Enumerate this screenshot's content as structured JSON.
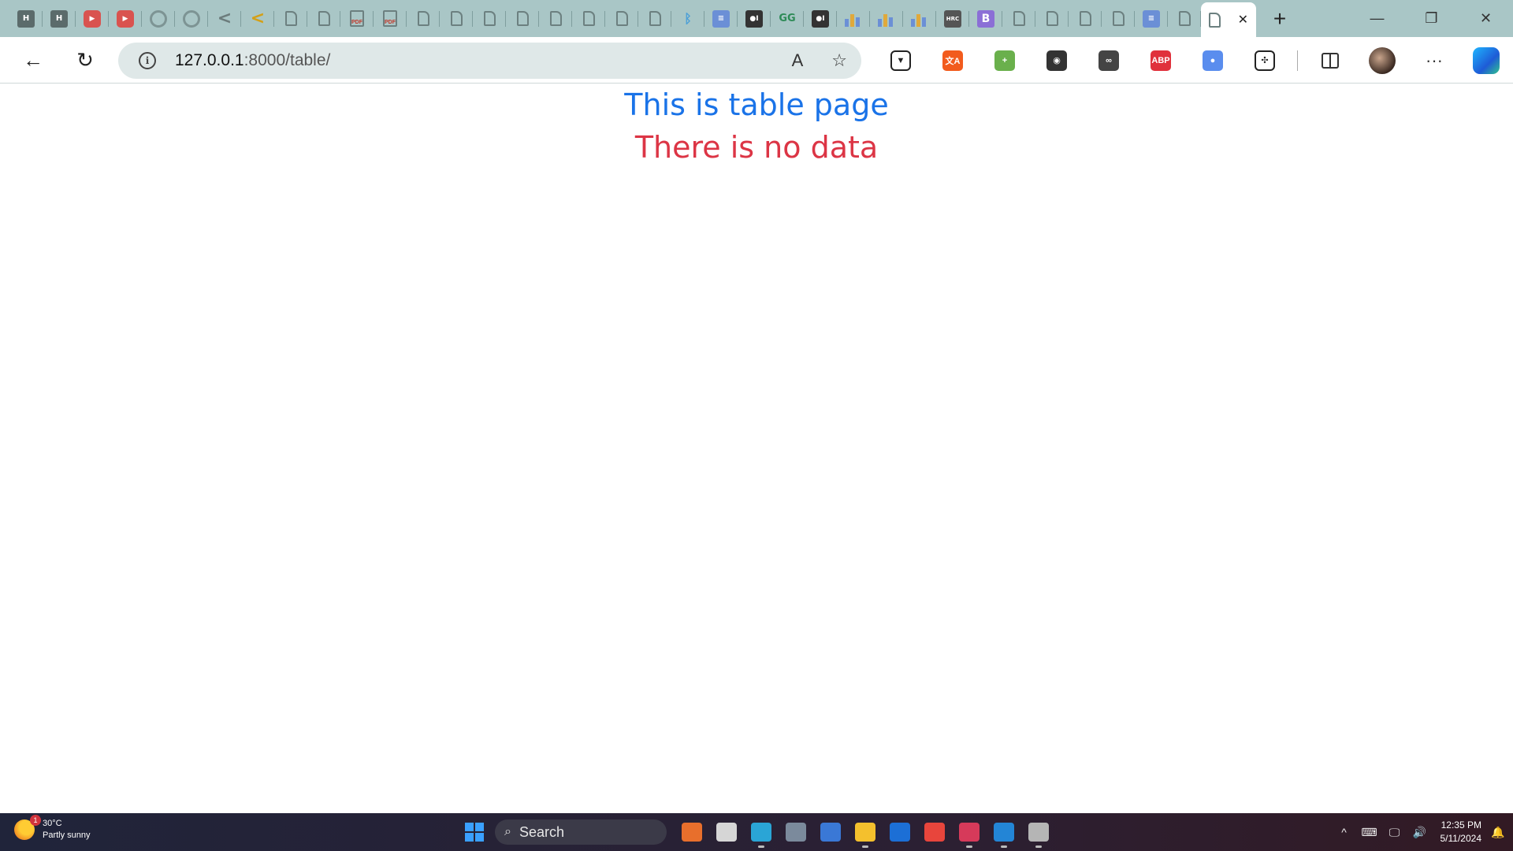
{
  "browser": {
    "tabs": [
      {
        "icon": "hr-icon",
        "label": "H"
      },
      {
        "icon": "hr-icon",
        "label": "H"
      },
      {
        "icon": "youtube-icon",
        "label": "▶"
      },
      {
        "icon": "youtube-icon",
        "label": "▶"
      },
      {
        "icon": "github-icon",
        "label": ""
      },
      {
        "icon": "chatgpt-icon",
        "label": ""
      },
      {
        "icon": "chevron-icon",
        "label": "<"
      },
      {
        "icon": "chevron-icon",
        "label": "<"
      },
      {
        "icon": "document-icon",
        "label": ""
      },
      {
        "icon": "document-icon",
        "label": ""
      },
      {
        "icon": "pdf-icon",
        "label": "PDF"
      },
      {
        "icon": "pdf-icon",
        "label": "PDF"
      },
      {
        "icon": "document-icon",
        "label": ""
      },
      {
        "icon": "document-icon",
        "label": ""
      },
      {
        "icon": "document-icon",
        "label": ""
      },
      {
        "icon": "document-icon",
        "label": ""
      },
      {
        "icon": "document-icon",
        "label": ""
      },
      {
        "icon": "document-icon",
        "label": ""
      },
      {
        "icon": "document-icon",
        "label": ""
      },
      {
        "icon": "document-icon",
        "label": ""
      },
      {
        "icon": "bluetooth-icon",
        "label": "ᛒ"
      },
      {
        "icon": "docs-icon",
        "label": "≡"
      },
      {
        "icon": "medium-icon",
        "label": "●I"
      },
      {
        "icon": "gfg-icon",
        "label": "GG"
      },
      {
        "icon": "medium-icon",
        "label": "●I"
      },
      {
        "icon": "chart-icon",
        "label": ""
      },
      {
        "icon": "chart-icon",
        "label": ""
      },
      {
        "icon": "chart-icon",
        "label": ""
      },
      {
        "icon": "hrc-icon",
        "label": "HRC"
      },
      {
        "icon": "bootstrap-icon",
        "label": "B"
      },
      {
        "icon": "document-icon",
        "label": ""
      },
      {
        "icon": "document-icon",
        "label": ""
      },
      {
        "icon": "document-icon",
        "label": ""
      },
      {
        "icon": "document-icon",
        "label": ""
      },
      {
        "icon": "docs-icon",
        "label": "≡"
      },
      {
        "icon": "document-icon",
        "label": ""
      }
    ],
    "active_tab": {
      "icon": "document-icon",
      "close": "✕"
    },
    "new_tab": "+",
    "window_controls": {
      "minimize": "—",
      "restore": "❐",
      "close": "✕"
    },
    "nav": {
      "back": "←",
      "reload": "↻"
    },
    "address": {
      "info": "i",
      "host": "127.0.0.1",
      "rest": ":8000/table/"
    },
    "omni_icons": {
      "read_aloud": "A",
      "favorite": "☆"
    },
    "extensions": [
      {
        "name": "shield-extension-icon",
        "label": "▼",
        "color": "#ffffff"
      },
      {
        "name": "translate-extension-icon",
        "label": "文A",
        "color": "#f25b1d"
      },
      {
        "name": "plus-extension-icon",
        "label": "+",
        "color": "#6ab04c"
      },
      {
        "name": "color-picker-extension-icon",
        "label": "◉",
        "color": "#333333"
      },
      {
        "name": "spy-extension-icon",
        "label": "∞",
        "color": "#444444"
      },
      {
        "name": "adblock-extension-icon",
        "label": "ABP",
        "color": "#e0313c"
      },
      {
        "name": "multi-extension-icon",
        "label": "●",
        "color": "#5a8dee"
      },
      {
        "name": "puzzle-extensions-icon",
        "label": "✣",
        "color": "#ffffff"
      }
    ],
    "more": "···"
  },
  "page": {
    "heading": "This is table page",
    "message": "There is no data",
    "heading_color": "#1a73e8",
    "message_color": "#dc3545"
  },
  "taskbar": {
    "weather": {
      "badge": "1",
      "temp": "30°C",
      "condition": "Partly sunny"
    },
    "search": {
      "label": "Search",
      "icon": "⌕"
    },
    "apps": [
      {
        "name": "copilot-app-icon",
        "color": "#e86f2c"
      },
      {
        "name": "task-view-icon",
        "color": "#d6d6d6"
      },
      {
        "name": "edge-app-icon",
        "color": "#2aa5d6"
      },
      {
        "name": "calculator-app-icon",
        "color": "#7b8a9c"
      },
      {
        "name": "notepad-app-icon",
        "color": "#3a78d6"
      },
      {
        "name": "file-explorer-icon",
        "color": "#f4c02d"
      },
      {
        "name": "mail-app-icon",
        "color": "#1c6fd6"
      },
      {
        "name": "chrome-app-icon",
        "color": "#e8453c"
      },
      {
        "name": "snipping-tool-icon",
        "color": "#d63a5a"
      },
      {
        "name": "vscode-app-icon",
        "color": "#2385d6"
      },
      {
        "name": "database-app-icon",
        "color": "#b5b5b5"
      }
    ],
    "tray": {
      "chevron": "^",
      "keyboard": "⌨",
      "network": "🖵",
      "volume": "🔊"
    },
    "clock": {
      "time": "12:35 PM",
      "date": "5/11/2024"
    },
    "notification": "🔔"
  }
}
